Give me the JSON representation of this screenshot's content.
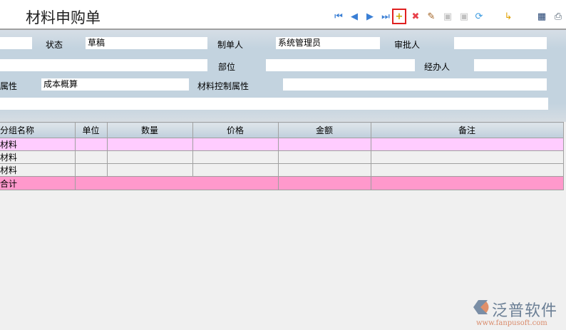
{
  "title": "材料申购单",
  "toolbar": [
    {
      "name": "first-record",
      "glyph": "⏮",
      "color": "#3a7fd5"
    },
    {
      "name": "prev-record",
      "glyph": "◀",
      "color": "#3a7fd5"
    },
    {
      "name": "next-record",
      "glyph": "▶",
      "color": "#3a7fd5"
    },
    {
      "name": "last-record",
      "glyph": "⏭",
      "color": "#3a7fd5"
    },
    {
      "name": "new-document",
      "glyph": "+",
      "color": "#c8a800"
    },
    {
      "name": "delete",
      "glyph": "✖",
      "color": "#e8404a"
    },
    {
      "name": "edit",
      "glyph": "✎",
      "color": "#a06020"
    },
    {
      "name": "approve",
      "glyph": "▣",
      "color": "#c0c0c0"
    },
    {
      "name": "unapprove",
      "glyph": "▣",
      "color": "#c0c0c0"
    },
    {
      "name": "refresh",
      "glyph": "⟳",
      "color": "#3a9ae0"
    },
    {
      "name": "export",
      "glyph": "↳",
      "color": "#e0a000"
    },
    {
      "name": "report",
      "glyph": "▦",
      "color": "#204070"
    },
    {
      "name": "print",
      "glyph": "⎙",
      "color": "#506070"
    }
  ],
  "form": {
    "status_label": "状态",
    "status_value": "草稿",
    "creator_label": "制单人",
    "creator_value": "系统管理员",
    "approver_label": "审批人",
    "approver_value": "",
    "part_label": "部位",
    "part_value": "",
    "handler_label": "经办人",
    "handler_value": "",
    "attr_label": "属性",
    "attr_value": "成本概算",
    "material_control_label": "材料控制属性",
    "material_control_value": ""
  },
  "table": {
    "headers": [
      "分组名称",
      "单位",
      "数量",
      "价格",
      "金额",
      "备注"
    ],
    "rows": [
      [
        "材料",
        "",
        "",
        "",
        "",
        ""
      ],
      [
        "材料",
        "",
        "",
        "",
        "",
        ""
      ],
      [
        "材料",
        "",
        "",
        "",
        "",
        ""
      ]
    ],
    "total_label": "合计"
  },
  "logo": {
    "name": "泛普软件",
    "url": "www.fanpusoft.com"
  }
}
